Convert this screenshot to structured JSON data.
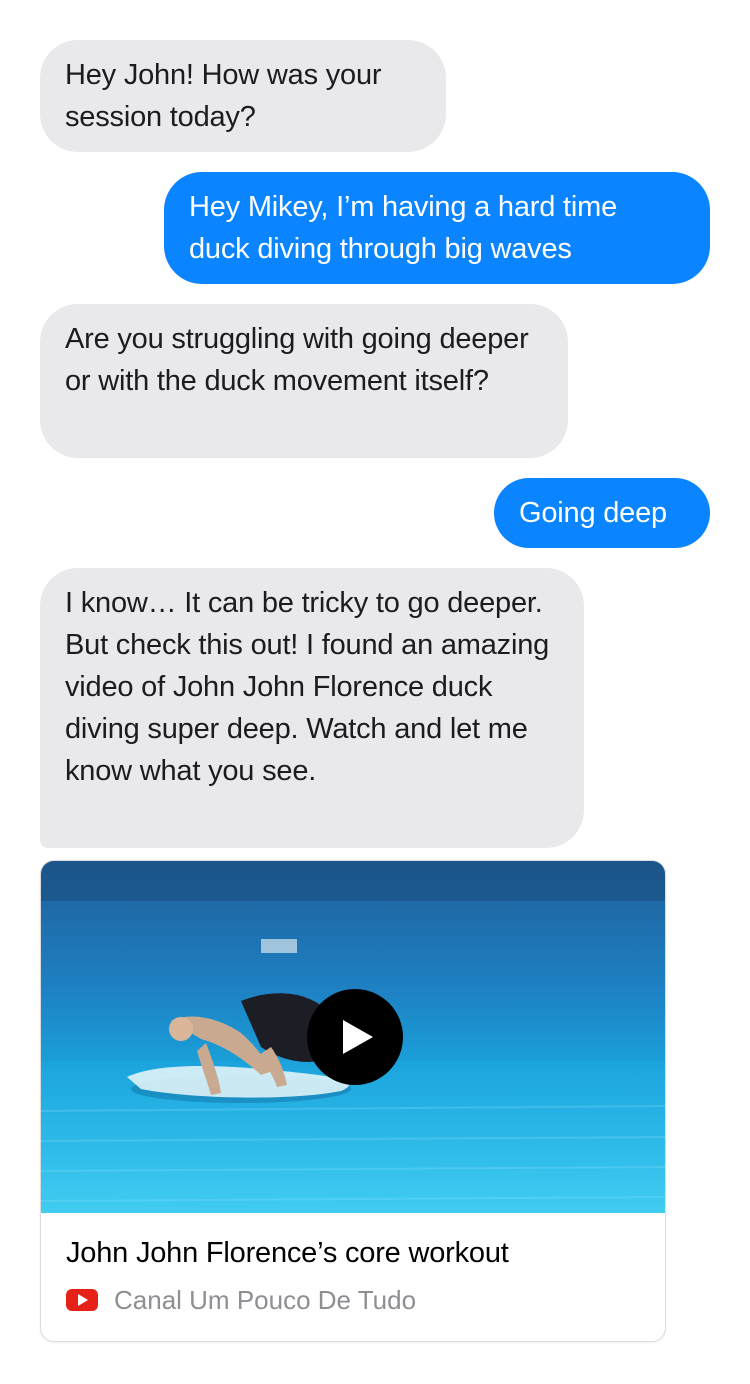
{
  "messages": [
    {
      "direction": "incoming",
      "text": "Hey John! How was your session today?"
    },
    {
      "direction": "outgoing",
      "text": "Hey Mikey, I’m having a hard time duck diving through big waves"
    },
    {
      "direction": "incoming",
      "text": "Are you struggling with going deeper or with the duck movement itself?"
    },
    {
      "direction": "outgoing",
      "text": "Going deep"
    },
    {
      "direction": "incoming",
      "text": "I know… It can be tricky to go deeper. But check this out! I found an amazing video of John John Florence duck diving super deep. Watch and let me know what you see."
    }
  ],
  "video_card": {
    "title": "John John Florence’s core workout",
    "source": "Canal Um Pouco De Tudo",
    "thumbnail": "underwater-surfer-duck-dive",
    "play_icon": "play-icon",
    "source_icon": "youtube-icon"
  },
  "colors": {
    "incoming_bubble": "#e9e9eb",
    "outgoing_bubble": "#0a84ff",
    "youtube_red": "#e62117",
    "source_text": "#8e8e93"
  }
}
